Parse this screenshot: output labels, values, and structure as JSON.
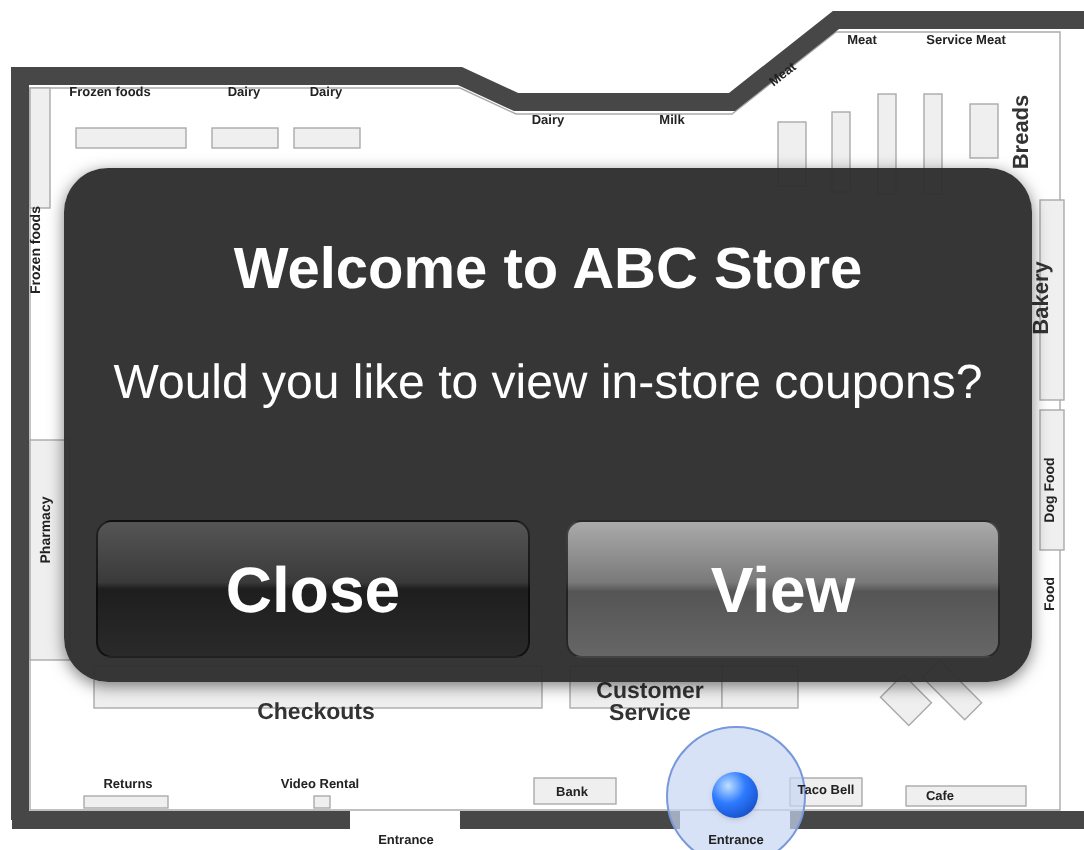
{
  "map": {
    "labels": [
      {
        "text": "Frozen foods",
        "kind": "label"
      },
      {
        "text": "Dairy",
        "kind": "label"
      },
      {
        "text": "Dairy",
        "kind": "label"
      },
      {
        "text": "Dairy",
        "kind": "label"
      },
      {
        "text": "Milk",
        "kind": "label"
      },
      {
        "text": "Meat",
        "kind": "label-slanted"
      },
      {
        "text": "Meat",
        "kind": "label"
      },
      {
        "text": "Service Meat",
        "kind": "label"
      },
      {
        "text": "Breads",
        "kind": "heading-vertical"
      },
      {
        "text": "Frozen foods",
        "kind": "label-vertical"
      },
      {
        "text": "Bakery",
        "kind": "heading-vertical"
      },
      {
        "text": "Pharmacy",
        "kind": "label-vertical"
      },
      {
        "text": "Dog Food",
        "kind": "label-vertical"
      },
      {
        "text": "Food",
        "kind": "label-vertical"
      },
      {
        "text": "Checkouts",
        "kind": "heading"
      },
      {
        "text": "Customer Service",
        "kind": "heading"
      },
      {
        "text": "Returns",
        "kind": "label"
      },
      {
        "text": "Video Rental",
        "kind": "label"
      },
      {
        "text": "Bank",
        "kind": "label"
      },
      {
        "text": "Taco Bell",
        "kind": "label"
      },
      {
        "text": "Cafe",
        "kind": "label"
      },
      {
        "text": "Entrance",
        "kind": "label"
      },
      {
        "text": "Entrance",
        "kind": "label"
      }
    ]
  },
  "alert": {
    "title": "Welcome to ABC Store",
    "message": "Would you like to view in-store coupons?",
    "buttons": [
      {
        "label": "Close",
        "kind": "cancel"
      },
      {
        "label": "View",
        "kind": "default"
      }
    ]
  }
}
